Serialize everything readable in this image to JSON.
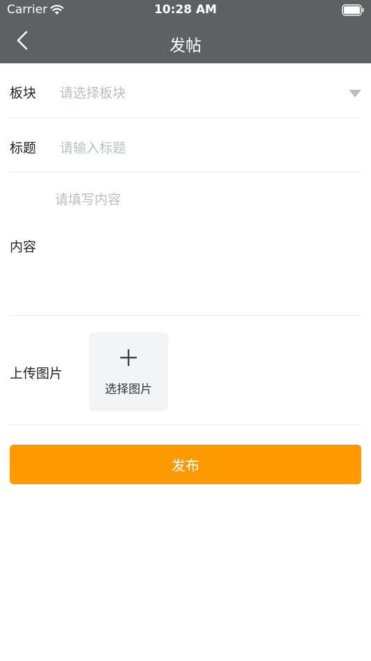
{
  "colors": {
    "header_bg": "#5f6064",
    "accent": "#ff9900",
    "tile_bg": "#f3f4f6",
    "placeholder": "#b9bdc6"
  },
  "status_bar": {
    "carrier": "Carrier",
    "time": "10:28 AM"
  },
  "nav": {
    "back_icon": "chevron-left-icon",
    "title": "发帖"
  },
  "form": {
    "board": {
      "label": "板块",
      "placeholder": "请选择板块",
      "icon": "triangle-down-icon"
    },
    "title": {
      "label": "标题",
      "placeholder": "请输入标题"
    },
    "content": {
      "label": "内容",
      "placeholder": "请填写内容"
    },
    "upload": {
      "label": "上传图片",
      "tile_label": "选择图片",
      "icon": "plus-icon"
    }
  },
  "submit": {
    "label": "发布"
  }
}
